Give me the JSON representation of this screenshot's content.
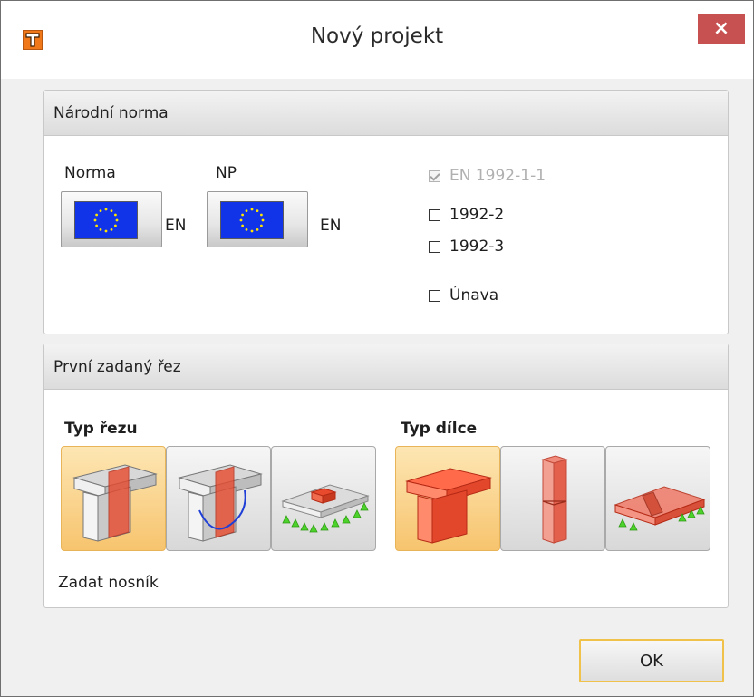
{
  "window": {
    "title": "Nový projekt",
    "close_glyph": "×"
  },
  "national_code": {
    "header": "Národní norma",
    "norma_label": "Norma",
    "norma_value": "EN",
    "np_label": "NP",
    "np_value": "EN",
    "checkboxes": [
      {
        "label": "EN 1992-1-1",
        "checked": true,
        "disabled": true
      },
      {
        "label": "1992-2",
        "checked": false,
        "disabled": false
      },
      {
        "label": "1992-3",
        "checked": false,
        "disabled": false
      },
      {
        "label": "Únava",
        "checked": false,
        "disabled": false
      }
    ]
  },
  "first_section": {
    "header": "První zadaný řez",
    "typ_rezu_label": "Typ řezu",
    "typ_dilce_label": "Typ dílce",
    "status_text": "Zadat nosník"
  },
  "footer": {
    "ok_label": "OK"
  },
  "colors": {
    "accent_selected": "#f7c46e",
    "close_red": "#c75050",
    "flag_blue": "#1234e8",
    "member_red": "#e84a2e"
  }
}
